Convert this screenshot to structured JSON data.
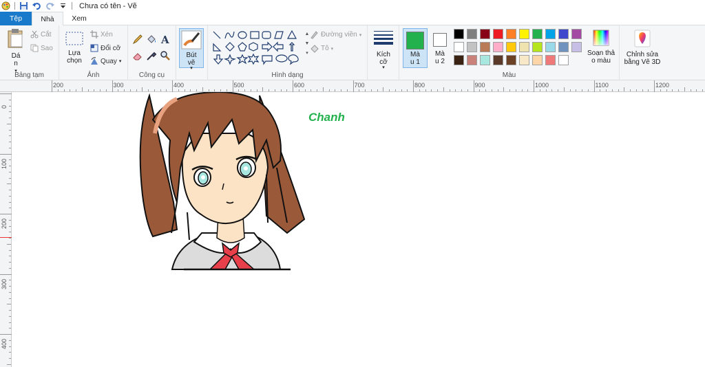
{
  "window": {
    "title": "Chưa có tên - Vẽ"
  },
  "tabs": {
    "file": "Tệp",
    "home": "Nhà",
    "view": "Xem"
  },
  "clipboard": {
    "paste": "Dá\nn",
    "cut": "Cắt",
    "copy": "Sao",
    "label": "Bảng tạm"
  },
  "image": {
    "select": "Lựa\nchọn",
    "crop": "Xén",
    "resize": "Đổi cỡ",
    "rotate": "Quay",
    "label": "Ảnh"
  },
  "tools": {
    "label": "Công cụ"
  },
  "brushes": {
    "label": "Bút\nvẽ"
  },
  "shapes": {
    "outline": "Đường viền",
    "fill": "Tô",
    "label": "Hình dạng"
  },
  "size": {
    "label": "Kích\ncỡ"
  },
  "colors": {
    "color1": "Mà\nu 1",
    "color2": "Mà\nu 2",
    "label": "Màu",
    "edit": "Soạn thả\no màu",
    "paint3d": "Chỉnh sửa\nbằng Vẽ 3D",
    "color1_value": "#22b14c",
    "color2_value": "#ffffff",
    "palette_row1": [
      "#000000",
      "#7f7f7f",
      "#880015",
      "#ed1c24",
      "#ff7f27",
      "#fff200",
      "#22b14c",
      "#00a2e8",
      "#3f48cc",
      "#a349a4"
    ],
    "palette_row2": [
      "#ffffff",
      "#c3c3c3",
      "#b97a57",
      "#ffaec9",
      "#ffc90e",
      "#efe4b0",
      "#b5e61d",
      "#99d9ea",
      "#7092be",
      "#c8bfe7"
    ],
    "palette_row3": [
      "#3b2314",
      "#c9817a",
      "#a8e6e0",
      "#5a3a28",
      "#6b4226",
      "#f7e8c8",
      "#fcd5a8",
      "#f07a7a",
      "#ffffff"
    ]
  },
  "ruler": {
    "h": [
      "200",
      "300",
      "400",
      "500",
      "600",
      "700",
      "800",
      "900",
      "1000",
      "1100",
      "1200"
    ],
    "v": [
      "0",
      "100",
      "200",
      "300",
      "400"
    ]
  },
  "canvas": {
    "text": "Chanh"
  }
}
